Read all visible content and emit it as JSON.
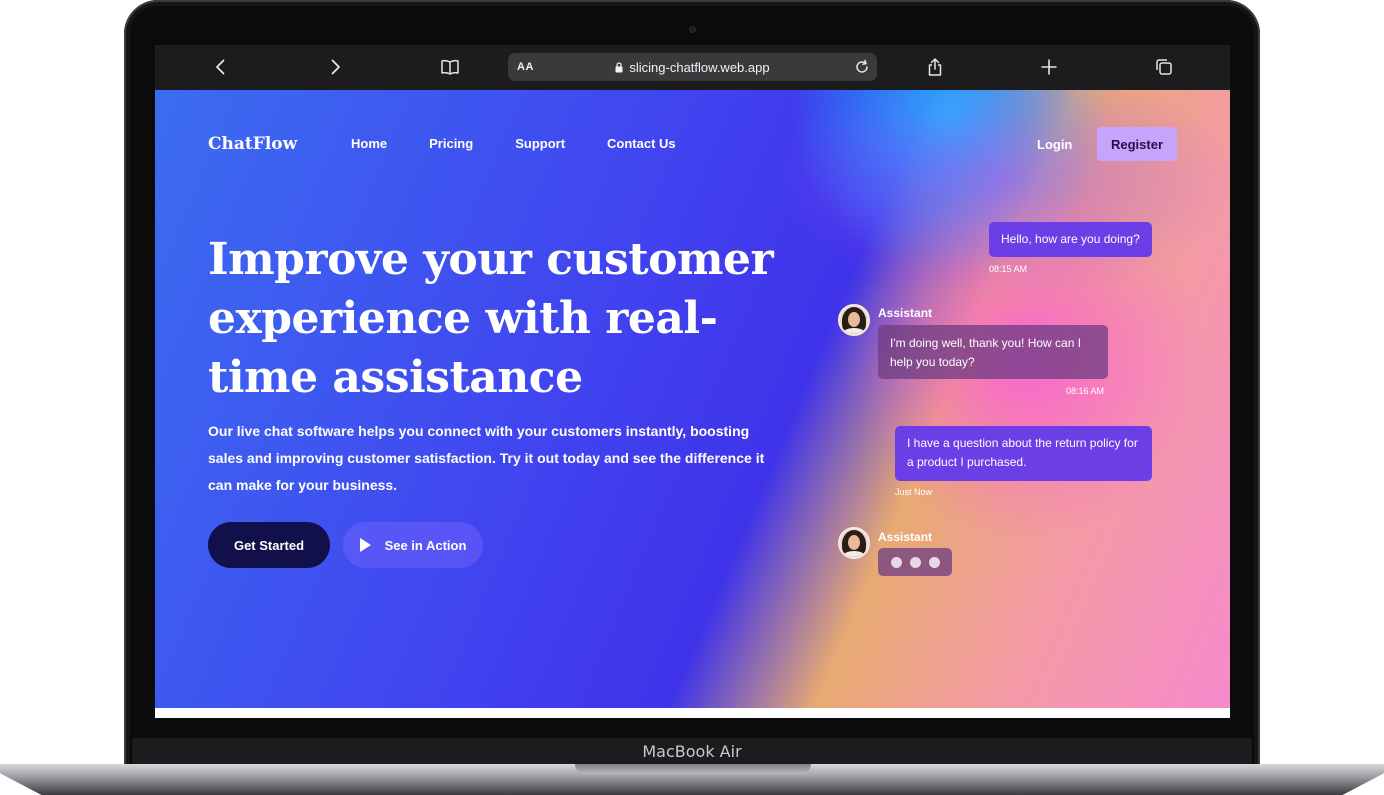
{
  "device": {
    "label": "MacBook Air"
  },
  "browser": {
    "aa_label": "AA",
    "url": "slicing-chatflow.web.app",
    "icons": [
      "back-icon",
      "forward-icon",
      "book-icon",
      "lock-icon",
      "reload-icon",
      "share-icon",
      "plus-icon",
      "tabs-icon"
    ]
  },
  "nav": {
    "brand": "ChatFlow",
    "links": [
      "Home",
      "Pricing",
      "Support",
      "Contact Us"
    ],
    "login": "Login",
    "register": "Register"
  },
  "hero": {
    "headline": "Improve your customer experience with real- time assistance",
    "subtext": "Our live chat software helps you connect with your customers instantly, boosting sales and improving customer satisfaction. Try it out today and see the difference it can make for your business.",
    "get_started": "Get Started",
    "see_in_action": "See in Action"
  },
  "chat": {
    "messages": [
      {
        "sender": "user",
        "text": "Hello, how are you doing?",
        "time": "08:15 AM"
      },
      {
        "sender": "assistant",
        "name": "Assistant",
        "text": "I'm doing well, thank you! How can I help you today?",
        "time": "08:16 AM"
      },
      {
        "sender": "user",
        "text": "I have a question about the return policy for a product I purchased.",
        "time": "Just Now"
      },
      {
        "sender": "assistant",
        "name": "Assistant",
        "typing": true
      }
    ]
  },
  "colors": {
    "register_bg": "#c7a4fb",
    "get_started_bg": "#12104a",
    "user_bubble": "#6c3ee6"
  }
}
